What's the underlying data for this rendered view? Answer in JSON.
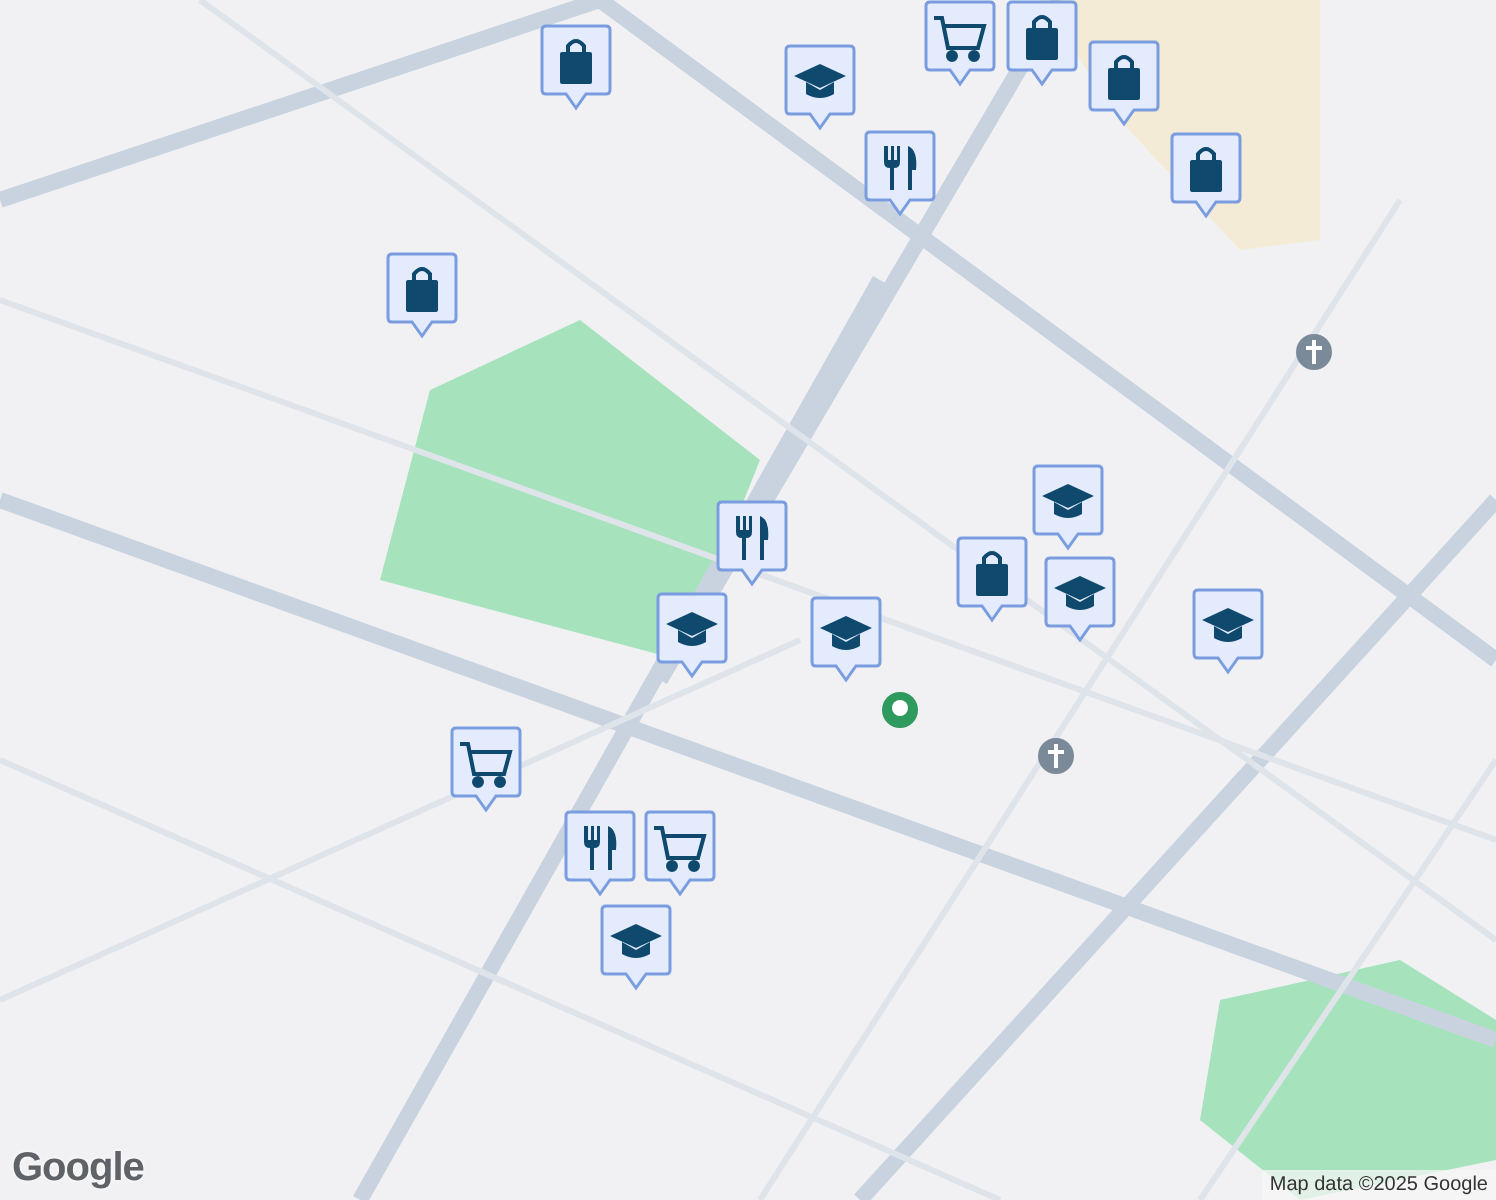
{
  "map": {
    "markers": [
      {
        "kind": "shopping"
      },
      {
        "kind": "shopping"
      },
      {
        "kind": "school"
      },
      {
        "kind": "grocery"
      },
      {
        "kind": "shopping"
      },
      {
        "kind": "shopping"
      },
      {
        "kind": "restaurant"
      },
      {
        "kind": "shopping"
      },
      {
        "kind": "restaurant"
      },
      {
        "kind": "school"
      },
      {
        "kind": "school"
      },
      {
        "kind": "shopping"
      },
      {
        "kind": "school"
      },
      {
        "kind": "school"
      },
      {
        "kind": "school"
      },
      {
        "kind": "grocery"
      },
      {
        "kind": "restaurant"
      },
      {
        "kind": "grocery"
      },
      {
        "kind": "school"
      }
    ]
  },
  "attribution": "Map data ©2025 Google",
  "logo": "Google"
}
